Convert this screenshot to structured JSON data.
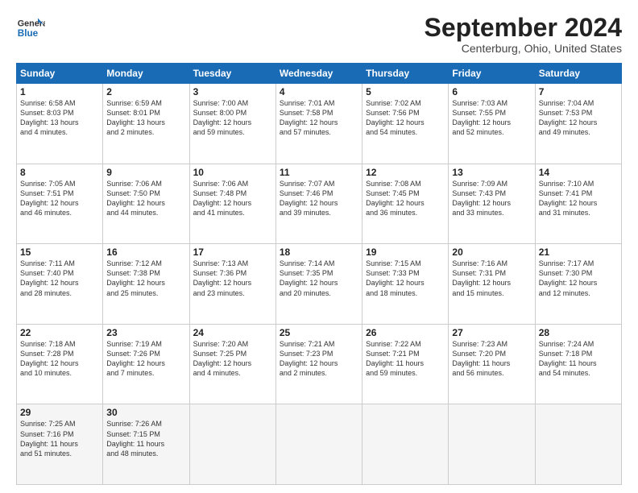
{
  "header": {
    "logo_line1": "General",
    "logo_line2": "Blue",
    "month": "September 2024",
    "location": "Centerburg, Ohio, United States"
  },
  "days_of_week": [
    "Sunday",
    "Monday",
    "Tuesday",
    "Wednesday",
    "Thursday",
    "Friday",
    "Saturday"
  ],
  "weeks": [
    [
      {
        "day": "1",
        "lines": [
          "Sunrise: 6:58 AM",
          "Sunset: 8:03 PM",
          "Daylight: 13 hours",
          "and 4 minutes."
        ]
      },
      {
        "day": "2",
        "lines": [
          "Sunrise: 6:59 AM",
          "Sunset: 8:01 PM",
          "Daylight: 13 hours",
          "and 2 minutes."
        ]
      },
      {
        "day": "3",
        "lines": [
          "Sunrise: 7:00 AM",
          "Sunset: 8:00 PM",
          "Daylight: 12 hours",
          "and 59 minutes."
        ]
      },
      {
        "day": "4",
        "lines": [
          "Sunrise: 7:01 AM",
          "Sunset: 7:58 PM",
          "Daylight: 12 hours",
          "and 57 minutes."
        ]
      },
      {
        "day": "5",
        "lines": [
          "Sunrise: 7:02 AM",
          "Sunset: 7:56 PM",
          "Daylight: 12 hours",
          "and 54 minutes."
        ]
      },
      {
        "day": "6",
        "lines": [
          "Sunrise: 7:03 AM",
          "Sunset: 7:55 PM",
          "Daylight: 12 hours",
          "and 52 minutes."
        ]
      },
      {
        "day": "7",
        "lines": [
          "Sunrise: 7:04 AM",
          "Sunset: 7:53 PM",
          "Daylight: 12 hours",
          "and 49 minutes."
        ]
      }
    ],
    [
      {
        "day": "8",
        "lines": [
          "Sunrise: 7:05 AM",
          "Sunset: 7:51 PM",
          "Daylight: 12 hours",
          "and 46 minutes."
        ]
      },
      {
        "day": "9",
        "lines": [
          "Sunrise: 7:06 AM",
          "Sunset: 7:50 PM",
          "Daylight: 12 hours",
          "and 44 minutes."
        ]
      },
      {
        "day": "10",
        "lines": [
          "Sunrise: 7:06 AM",
          "Sunset: 7:48 PM",
          "Daylight: 12 hours",
          "and 41 minutes."
        ]
      },
      {
        "day": "11",
        "lines": [
          "Sunrise: 7:07 AM",
          "Sunset: 7:46 PM",
          "Daylight: 12 hours",
          "and 39 minutes."
        ]
      },
      {
        "day": "12",
        "lines": [
          "Sunrise: 7:08 AM",
          "Sunset: 7:45 PM",
          "Daylight: 12 hours",
          "and 36 minutes."
        ]
      },
      {
        "day": "13",
        "lines": [
          "Sunrise: 7:09 AM",
          "Sunset: 7:43 PM",
          "Daylight: 12 hours",
          "and 33 minutes."
        ]
      },
      {
        "day": "14",
        "lines": [
          "Sunrise: 7:10 AM",
          "Sunset: 7:41 PM",
          "Daylight: 12 hours",
          "and 31 minutes."
        ]
      }
    ],
    [
      {
        "day": "15",
        "lines": [
          "Sunrise: 7:11 AM",
          "Sunset: 7:40 PM",
          "Daylight: 12 hours",
          "and 28 minutes."
        ]
      },
      {
        "day": "16",
        "lines": [
          "Sunrise: 7:12 AM",
          "Sunset: 7:38 PM",
          "Daylight: 12 hours",
          "and 25 minutes."
        ]
      },
      {
        "day": "17",
        "lines": [
          "Sunrise: 7:13 AM",
          "Sunset: 7:36 PM",
          "Daylight: 12 hours",
          "and 23 minutes."
        ]
      },
      {
        "day": "18",
        "lines": [
          "Sunrise: 7:14 AM",
          "Sunset: 7:35 PM",
          "Daylight: 12 hours",
          "and 20 minutes."
        ]
      },
      {
        "day": "19",
        "lines": [
          "Sunrise: 7:15 AM",
          "Sunset: 7:33 PM",
          "Daylight: 12 hours",
          "and 18 minutes."
        ]
      },
      {
        "day": "20",
        "lines": [
          "Sunrise: 7:16 AM",
          "Sunset: 7:31 PM",
          "Daylight: 12 hours",
          "and 15 minutes."
        ]
      },
      {
        "day": "21",
        "lines": [
          "Sunrise: 7:17 AM",
          "Sunset: 7:30 PM",
          "Daylight: 12 hours",
          "and 12 minutes."
        ]
      }
    ],
    [
      {
        "day": "22",
        "lines": [
          "Sunrise: 7:18 AM",
          "Sunset: 7:28 PM",
          "Daylight: 12 hours",
          "and 10 minutes."
        ]
      },
      {
        "day": "23",
        "lines": [
          "Sunrise: 7:19 AM",
          "Sunset: 7:26 PM",
          "Daylight: 12 hours",
          "and 7 minutes."
        ]
      },
      {
        "day": "24",
        "lines": [
          "Sunrise: 7:20 AM",
          "Sunset: 7:25 PM",
          "Daylight: 12 hours",
          "and 4 minutes."
        ]
      },
      {
        "day": "25",
        "lines": [
          "Sunrise: 7:21 AM",
          "Sunset: 7:23 PM",
          "Daylight: 12 hours",
          "and 2 minutes."
        ]
      },
      {
        "day": "26",
        "lines": [
          "Sunrise: 7:22 AM",
          "Sunset: 7:21 PM",
          "Daylight: 11 hours",
          "and 59 minutes."
        ]
      },
      {
        "day": "27",
        "lines": [
          "Sunrise: 7:23 AM",
          "Sunset: 7:20 PM",
          "Daylight: 11 hours",
          "and 56 minutes."
        ]
      },
      {
        "day": "28",
        "lines": [
          "Sunrise: 7:24 AM",
          "Sunset: 7:18 PM",
          "Daylight: 11 hours",
          "and 54 minutes."
        ]
      }
    ],
    [
      {
        "day": "29",
        "lines": [
          "Sunrise: 7:25 AM",
          "Sunset: 7:16 PM",
          "Daylight: 11 hours",
          "and 51 minutes."
        ]
      },
      {
        "day": "30",
        "lines": [
          "Sunrise: 7:26 AM",
          "Sunset: 7:15 PM",
          "Daylight: 11 hours",
          "and 48 minutes."
        ]
      },
      null,
      null,
      null,
      null,
      null
    ]
  ]
}
